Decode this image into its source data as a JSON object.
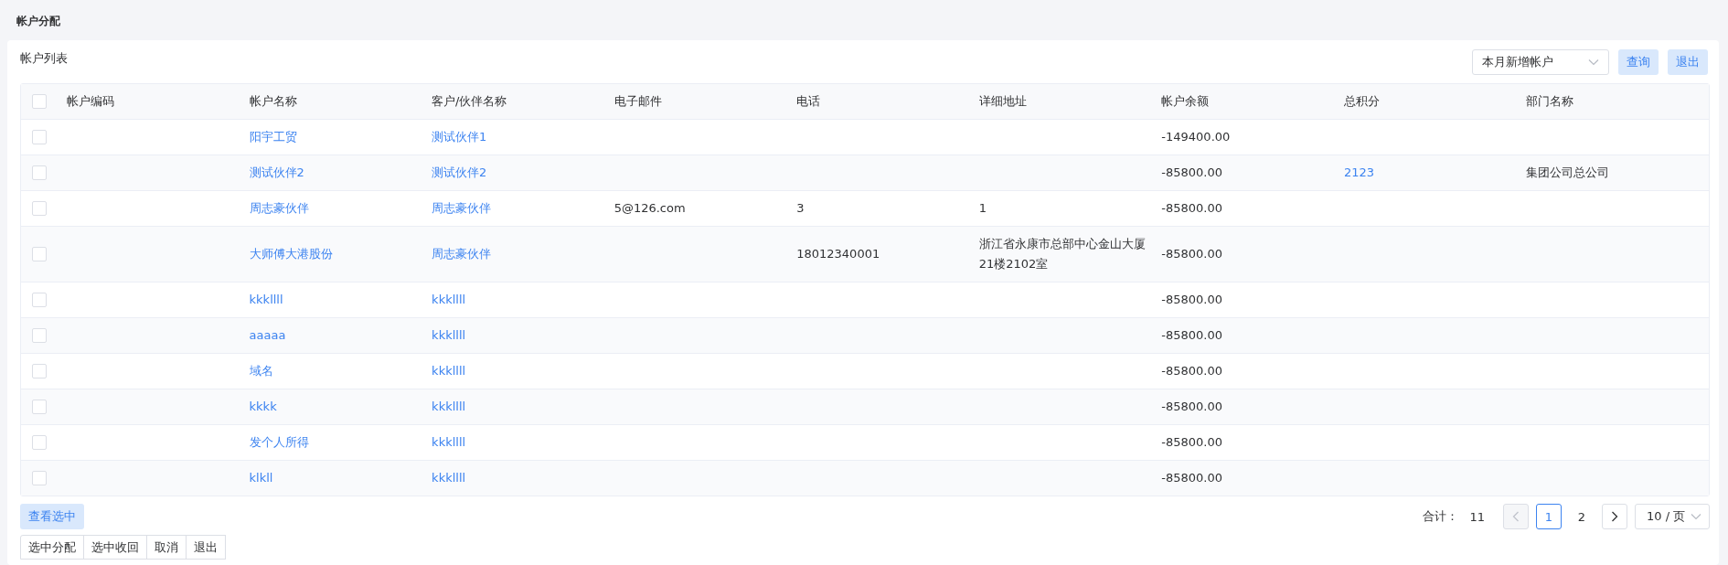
{
  "page_title": "帐户分配",
  "panel_title": "帐户列表",
  "filter": {
    "value": "本月新增帐户"
  },
  "top_buttons": [
    "查询",
    "退出"
  ],
  "table": {
    "header_checked": false,
    "columns": [
      {
        "label": "帐户编码"
      },
      {
        "label": "帐户名称",
        "kind": "link"
      },
      {
        "label": "客户/伙伴名称",
        "kind": "link"
      },
      {
        "label": "电子邮件",
        "kind": "text"
      },
      {
        "label": "电话",
        "kind": "text"
      },
      {
        "label": "详细地址",
        "kind": "text"
      },
      {
        "label": "帐户余额",
        "kind": "text"
      },
      {
        "label": "总积分",
        "kind": "link"
      },
      {
        "label": "部门名称",
        "kind": "text"
      }
    ],
    "rows": [
      {
        "selected": false,
        "cells": [
          null,
          "阳宇工贸",
          "测试伙伴1",
          null,
          null,
          null,
          "-149400.00",
          null,
          null
        ]
      },
      {
        "selected": false,
        "cells": [
          null,
          "测试伙伴2",
          "测试伙伴2",
          null,
          null,
          null,
          "-85800.00",
          "2123",
          "集团公司总公司"
        ]
      },
      {
        "selected": false,
        "cells": [
          null,
          "周志豪伙伴",
          "周志豪伙伴",
          "5@126.com",
          "3",
          "1",
          "-85800.00",
          null,
          null
        ]
      },
      {
        "selected": false,
        "cells": [
          null,
          "大师傅大港股份",
          "周志豪伙伴",
          null,
          "18012340001",
          "浙江省永康市总部中心金山大厦21楼2102室",
          "-85800.00",
          null,
          null
        ]
      },
      {
        "selected": false,
        "cells": [
          null,
          "kkkllll",
          "kkkllll",
          null,
          null,
          null,
          "-85800.00",
          null,
          null
        ]
      },
      {
        "selected": false,
        "cells": [
          null,
          "aaaaa",
          "kkkllll",
          null,
          null,
          null,
          "-85800.00",
          null,
          null
        ]
      },
      {
        "selected": false,
        "cells": [
          null,
          "域名",
          "kkkllll",
          null,
          null,
          null,
          "-85800.00",
          null,
          null
        ]
      },
      {
        "selected": false,
        "cells": [
          null,
          "kkkk",
          "kkkllll",
          null,
          null,
          null,
          "-85800.00",
          null,
          null
        ]
      },
      {
        "selected": false,
        "cells": [
          null,
          "发个人所得",
          "kkkllll",
          null,
          null,
          null,
          "-85800.00",
          null,
          null
        ]
      },
      {
        "selected": false,
        "cells": [
          null,
          "klkll",
          "kkkllll",
          null,
          null,
          null,
          "-85800.00",
          null,
          null
        ]
      }
    ]
  },
  "view_selected_button": "查看选中",
  "pagination": {
    "total_label": "合计：",
    "total": "11",
    "prev_disabled": true,
    "next_disabled": false,
    "pages": [
      {
        "label": "1",
        "selected": true
      },
      {
        "label": "2",
        "selected": false
      }
    ],
    "page_size": "10 / 页"
  },
  "action_buttons": [
    "选中分配",
    "选中收回",
    "取消",
    "退出"
  ]
}
